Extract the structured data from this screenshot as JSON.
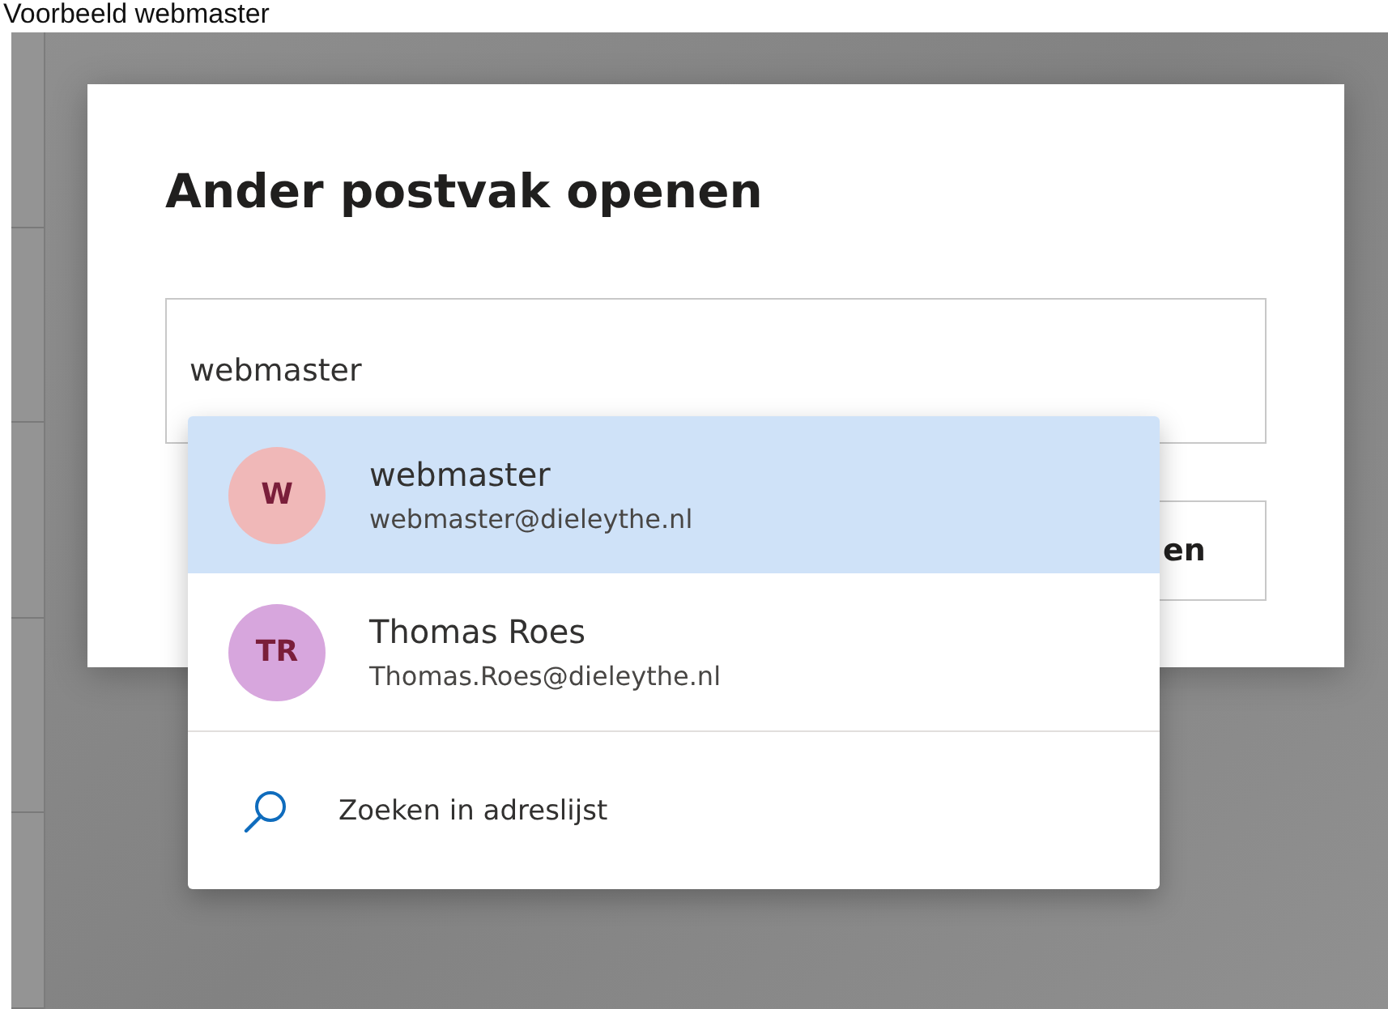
{
  "caption": "Voorbeeld webmaster",
  "dialog": {
    "title": "Ander postvak openen",
    "input": {
      "value": "webmaster"
    },
    "button_partial": "en"
  },
  "suggestions": [
    {
      "initials": "W",
      "name": "webmaster",
      "email": "webmaster@dieleythe.nl",
      "color": "#f0b8b8",
      "selected": true
    },
    {
      "initials": "TR",
      "name": "Thomas Roes",
      "email": "Thomas.Roes@dieleythe.nl",
      "color": "#d7a6dd",
      "selected": false
    }
  ],
  "search_directory": {
    "label": "Zoeken in adreslijst"
  }
}
